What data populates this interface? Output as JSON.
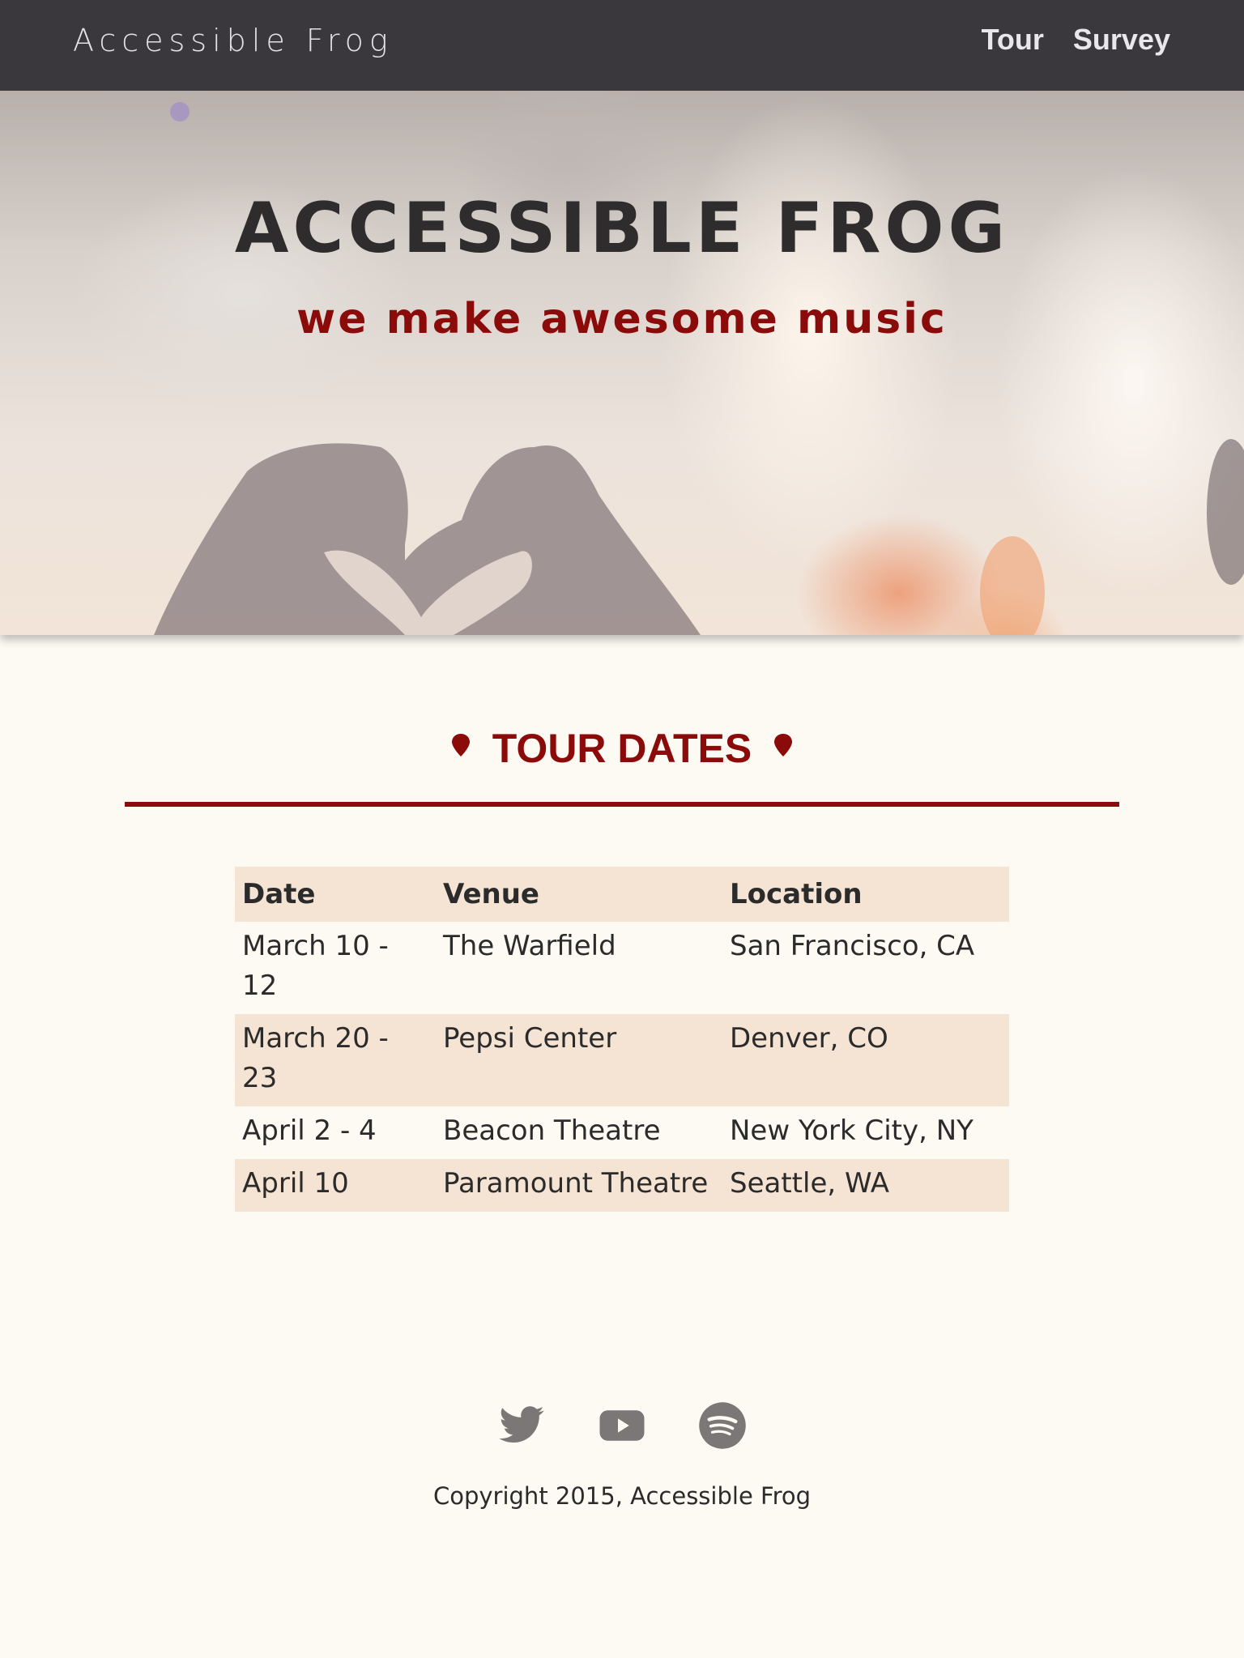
{
  "nav": {
    "brand": "Accessible Frog",
    "links": [
      {
        "label": "Tour"
      },
      {
        "label": "Survey"
      }
    ]
  },
  "hero": {
    "title": "ACCESSIBLE FROG",
    "subtitle": "we make awesome music"
  },
  "tour": {
    "heading": "TOUR DATES",
    "columns": [
      "Date",
      "Venue",
      "Location"
    ],
    "rows": [
      {
        "date": "March 10 - 12",
        "venue": "The Warfield",
        "location": "San Francisco, CA"
      },
      {
        "date": "March 20 - 23",
        "venue": "Pepsi Center",
        "location": "Denver, CO"
      },
      {
        "date": "April 2 - 4",
        "venue": "Beacon Theatre",
        "location": "New York City, NY"
      },
      {
        "date": "April 10",
        "venue": "Paramount Theatre",
        "location": "Seattle, WA"
      }
    ]
  },
  "footer": {
    "social": [
      "twitter-icon",
      "youtube-icon",
      "spotify-icon"
    ],
    "copyright": "Copyright 2015, Accessible Frog"
  },
  "colors": {
    "accent": "#8b0a0a",
    "navbar": "#3a383d",
    "table_stripe": "#f5e4d3",
    "page_background": "#fdfaf3",
    "icon_gray": "#7a7776"
  }
}
